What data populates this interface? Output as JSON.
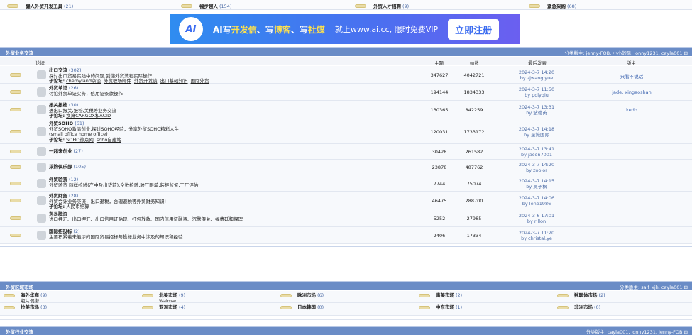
{
  "top_row": [
    {
      "name": "懒人外贸开发工具",
      "count": "(21)"
    },
    {
      "name": "福步超人",
      "count": "(154)"
    },
    {
      "name": "外贸人才招聘",
      "count": "(9)"
    },
    {
      "name": "紧急采购",
      "count": "(68)"
    }
  ],
  "banner": {
    "logo": "AI",
    "t1": "AI写",
    "t2": "开发信",
    "t3": "、写",
    "t4": "博客",
    "t5": "、写",
    "t6": "社媒",
    "site": "就上www.ai.cc, 限时免费VIP",
    "button": "立即注册"
  },
  "section1": {
    "title": "外贸业务交流",
    "mods": "分类版主: jenny-FOB, 小小的风, lonny1231, cayla001 ⊟",
    "columns": {
      "forum": "论坛",
      "topics": "主题",
      "posts": "帖数",
      "last": "最后发表",
      "mod": "版主"
    },
    "forums": [
      {
        "name": "出口交流",
        "count": "(302)",
        "desc": "探讨出口贸易实践中的问题,到懂外贸流程实际操作",
        "sub_label": "子论坛:",
        "subs": [
          "chemyland杂谈",
          "外贸职场邮件",
          "外贸开发谈",
          "出口基础知识",
          "国际外贸"
        ],
        "icon": "chat-icon",
        "topics": "347627",
        "posts": "4042721",
        "last_date": "2024-3-7 14:20",
        "last_by": "by zjwanglyue",
        "mod": "只看不说话"
      },
      {
        "name": "外贸单证",
        "count": "(26)",
        "desc": "讨论外贸单证实务，信用证条款操作",
        "subs": [],
        "icon": "document-icon",
        "topics": "194144",
        "posts": "1834333",
        "last_date": "2024-3-7 11:50",
        "last_by": "by polyqiu",
        "mod": "jade, xingaoshan"
      },
      {
        "name": "报关报检",
        "count": "(30)",
        "desc": "进出口报关,报检,关税等业务交流",
        "sub_label": "子论坛:",
        "subs": [
          "换算CARGOX和ACID"
        ],
        "icon": "chart-icon",
        "topics": "130365",
        "posts": "842259",
        "last_date": "2024-3-7 13:31",
        "last_by": "by 波德芮",
        "mod": "kedo"
      },
      {
        "name": "外贸SOHO",
        "count": "(61)",
        "desc": "外贸SOHO激情创业,探讨SOHO经验，分享外贸SOHO精彩人生",
        "desc2": "(small office home office)",
        "sub_label": "子论坛:",
        "subs": [
          "SOHO热点网",
          "soho自建站"
        ],
        "icon": "person-icon",
        "topics": "120031",
        "posts": "1733172",
        "last_date": "2024-3-7 14:18",
        "last_by": "by 至诚国际",
        "mod": ""
      },
      {
        "name": "一起来创业",
        "count": "(27)",
        "desc": "",
        "subs": [],
        "icon": "group-icon",
        "topics": "30428",
        "posts": "261582",
        "last_date": "2024-3-7 13:41",
        "last_by": "by jacen7001",
        "mod": ""
      },
      {
        "name": "采购俱乐部",
        "count": "(105)",
        "desc": "",
        "subs": [],
        "icon": "cart-icon",
        "topics": "23878",
        "posts": "487762",
        "last_date": "2024-3-7 14:20",
        "last_by": "by zoolor",
        "mod": ""
      },
      {
        "name": "外贸验货",
        "count": "(12)",
        "desc": "外贸验货 随样检验(产中及出货前),全数检验,验厂跟单,装柜监督,工厂评估",
        "subs": [],
        "icon": "clipboard-icon",
        "topics": "7744",
        "posts": "75074",
        "last_date": "2024-3-7 14:15",
        "last_by": "by 吴子枫",
        "mod": ""
      },
      {
        "name": "外贸财务",
        "count": "(28)",
        "desc": "外贸会计业务交流，出口退税，合理避税等外贸财务知识!",
        "sub_label": "子论坛:",
        "subs": [
          "人民币结算"
        ],
        "icon": "calculator-icon",
        "topics": "46475",
        "posts": "288700",
        "last_date": "2024-3-7 14:06",
        "last_by": "by leno1986",
        "mod": ""
      },
      {
        "name": "贸易融资",
        "count": "",
        "desc": "进口押汇、出口押汇、出口信用证贴现、打包放款、国内信用证融资、沉默保兑、福费廷和保理",
        "subs": [],
        "icon": "money-bag-icon",
        "topics": "5252",
        "posts": "27985",
        "last_date": "2024-3-6 17:01",
        "last_by": "by rillon",
        "mod": ""
      },
      {
        "name": "国际招投标",
        "count": "(2)",
        "desc": "主要积累着未能涉的国际贸易招标与投标业务中涉及的知识和经验",
        "subs": [],
        "icon": "target-icon",
        "topics": "2406",
        "posts": "17334",
        "last_date": "2024-3-7 11:20",
        "last_by": "by christal.ye",
        "mod": ""
      }
    ]
  },
  "section2": {
    "title": "外贸区域市场",
    "mods": "分类版主: saif_xjh, cayla001 ⊟",
    "markets": [
      {
        "name": "海外华商",
        "count": "(9)",
        "sub": "瓶片侃街"
      },
      {
        "name": "北美市场",
        "count": "(9)",
        "sub": "Walmart"
      },
      {
        "name": "欧洲市场",
        "count": "(6)"
      },
      {
        "name": "南美市场",
        "count": "(2)"
      },
      {
        "name": "独联体市场",
        "count": "(2)"
      },
      {
        "name": "拉美市场",
        "count": "(3)"
      },
      {
        "name": "亚洲市场",
        "count": "(4)"
      },
      {
        "name": "日本韩国",
        "count": "(0)"
      },
      {
        "name": "中东市场",
        "count": "(1)"
      },
      {
        "name": "非洲市场",
        "count": "(0)"
      }
    ]
  },
  "section3": {
    "title": "外贸行业交流",
    "mods": "分类版主: cayla001, lonny1231, jenny-FOB ⊟"
  }
}
